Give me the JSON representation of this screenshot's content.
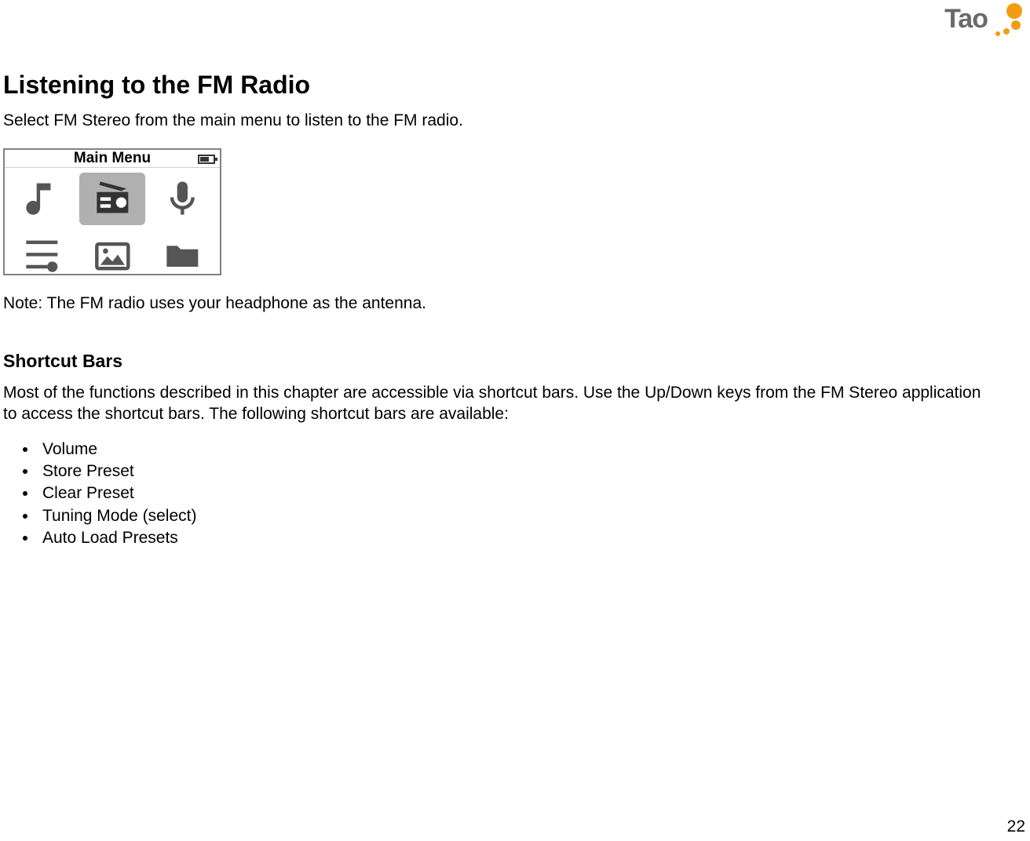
{
  "logo": {
    "text": "Tao"
  },
  "heading": "Listening to the FM Radio",
  "intro": "Select FM Stereo from the main menu to listen to the FM radio.",
  "screenshot": {
    "title": "Main Menu",
    "icons": [
      {
        "name": "music-icon"
      },
      {
        "name": "radio-icon",
        "selected": true
      },
      {
        "name": "mic-icon"
      },
      {
        "name": "settings-icon"
      },
      {
        "name": "photos-icon"
      },
      {
        "name": "folder-icon"
      }
    ]
  },
  "note": "Note: The FM radio uses your headphone as the antenna.",
  "subheading": "Shortcut Bars",
  "subtext": "Most of the functions described in this chapter are accessible via shortcut bars.  Use the Up/Down keys from the FM Stereo application to access the shortcut bars.  The following shortcut bars are available:",
  "bullets": [
    "Volume",
    "Store Preset",
    "Clear Preset",
    "Tuning Mode (select)",
    "Auto Load Presets"
  ],
  "page_number": "22"
}
